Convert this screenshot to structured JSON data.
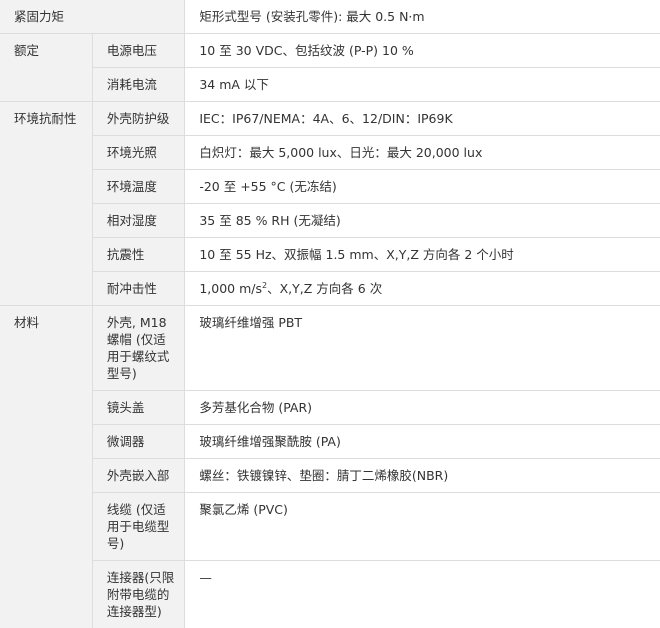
{
  "spec_table": {
    "tightening_torque": {
      "label": "紧固力矩",
      "value": "矩形式型号 (安装孔零件): 最大 0.5 N·m"
    },
    "rating": {
      "label": "额定",
      "rows": [
        {
          "label": "电源电压",
          "value": "10 至 30 VDC、包括纹波 (P-P) 10 %"
        },
        {
          "label": "消耗电流",
          "value": "34 mA 以下"
        }
      ]
    },
    "environment": {
      "label": "环境抗耐性",
      "rows": [
        {
          "label": "外壳防护级",
          "value": "IEC：IP67/NEMA：4A、6、12/DIN：IP69K"
        },
        {
          "label": "环境光照",
          "value": "白炽灯：最大 5,000 lux、日光：最大 20,000 lux"
        },
        {
          "label": "环境温度",
          "value": "-20 至 +55 °C (无冻结)"
        },
        {
          "label": "相对湿度",
          "value": "35 至 85 % RH (无凝结)"
        },
        {
          "label": "抗震性",
          "value": "10 至 55 Hz、双振幅 1.5 mm、X,Y,Z 方向各 2 个小时"
        },
        {
          "label": "耐冲击性",
          "value_main": "1,000 m/s",
          "value_sup": "2",
          "value_rest": "、X,Y,Z 方向各 6 次"
        }
      ]
    },
    "material": {
      "label": "材料",
      "rows": [
        {
          "label": "外壳, M18 螺帽 (仅适用于螺纹式型号)",
          "value": "玻璃纤维增强 PBT"
        },
        {
          "label": "镜头盖",
          "value": "多芳基化合物 (PAR)"
        },
        {
          "label": "微调器",
          "value": "玻璃纤维增强聚酰胺 (PA)"
        },
        {
          "label": "外壳嵌入部",
          "value": "螺丝：铁镀镍锌、垫圈：腈丁二烯橡胶(NBR)"
        },
        {
          "label": "线缆 (仅适用于电缆型号)",
          "value": "聚氯乙烯 (PVC)"
        },
        {
          "label": "连接器(只限附带电缆的连接器型)",
          "value": "—"
        }
      ]
    }
  }
}
